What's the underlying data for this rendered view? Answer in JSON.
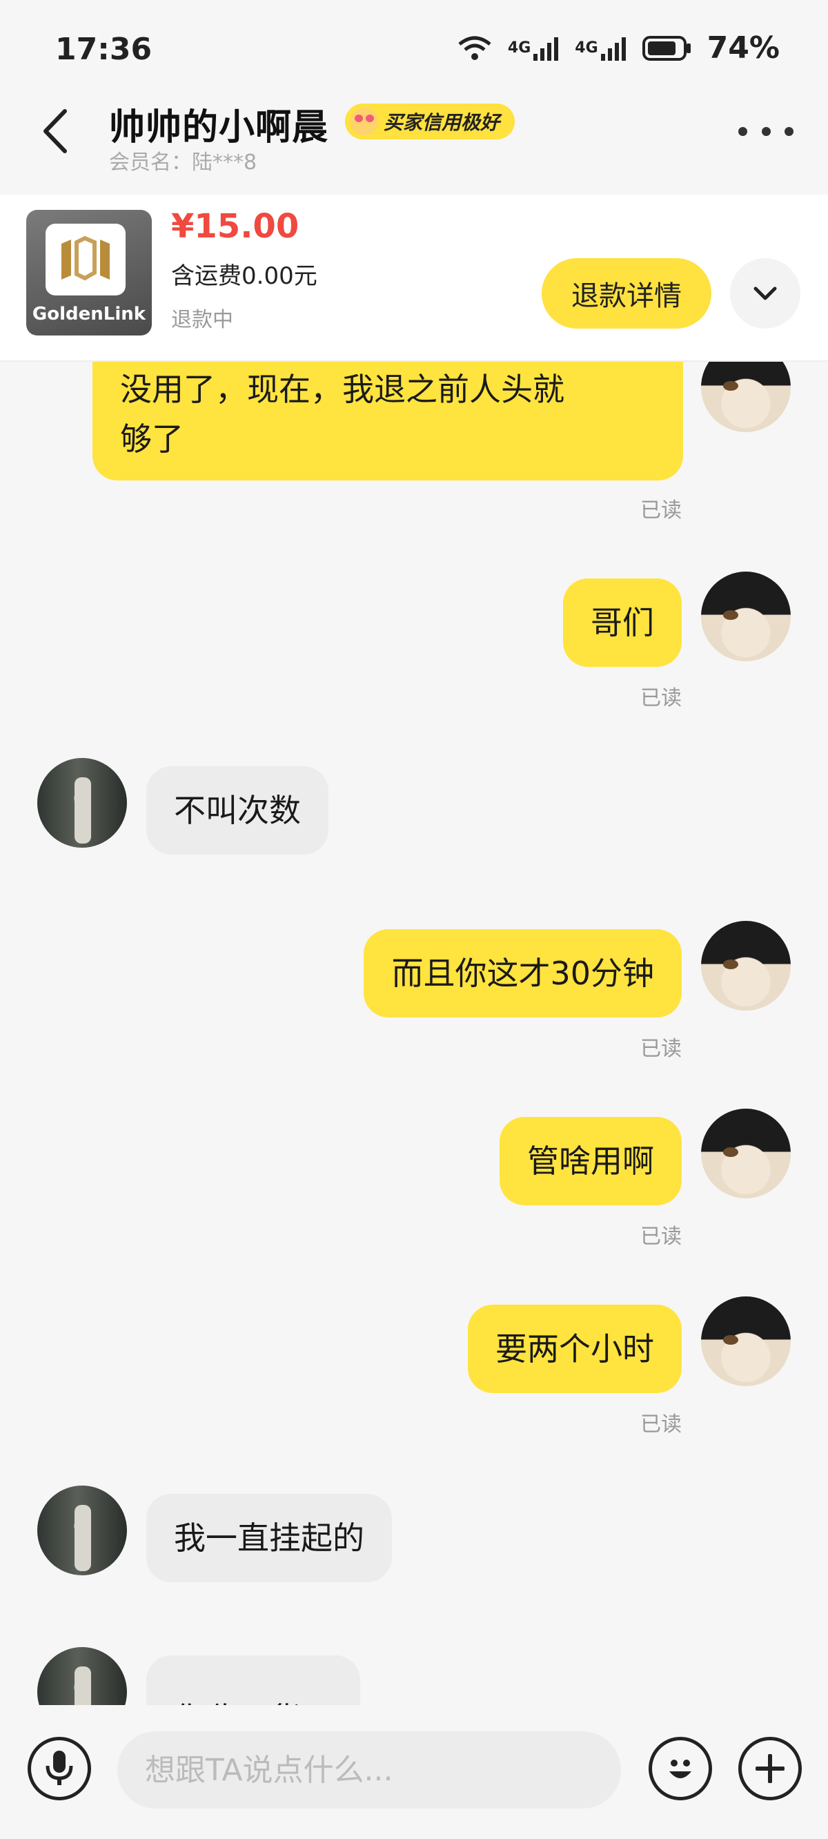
{
  "status_bar": {
    "time": "17:36",
    "battery": "74%",
    "network_1": "4G",
    "network_2": "4G"
  },
  "header": {
    "title": "帅帅的小啊晨",
    "credit_badge": "买家信用极好",
    "member_label": "会员名：陆***8",
    "icons": [
      "back-arrow-icon",
      "more-dots-icon"
    ]
  },
  "product": {
    "brand": "GoldenLink",
    "price": "¥15.00",
    "shipping": "含运费0.00元",
    "status": "退款中",
    "refund_button": "退款详情",
    "expand_icon": "chevron-down-icon"
  },
  "messages": [
    {
      "side": "out",
      "text_lines": [
        "没用了，现在，我退之前人头就",
        "够了"
      ],
      "read": "已读"
    },
    {
      "side": "out",
      "text": "哥们",
      "read": "已读"
    },
    {
      "side": "in",
      "text": "不叫次数"
    },
    {
      "side": "out",
      "text": "而且你这才30分钟",
      "read": "已读"
    },
    {
      "side": "out",
      "text": "管啥用啊",
      "read": "已读"
    },
    {
      "side": "out",
      "text": "要两个小时",
      "read": "已读"
    },
    {
      "side": "in",
      "text": "我一直挂起的"
    },
    {
      "side": "in",
      "text": "你收下货吧"
    }
  ],
  "input_bar": {
    "placeholder": "想跟TA说点什么...",
    "icons": [
      "microphone-icon",
      "smiley-icon",
      "plus-icon"
    ]
  },
  "colors": {
    "accent_yellow": "#ffe33f",
    "price_red": "#f0493f",
    "incoming_bubble": "#ececec"
  }
}
